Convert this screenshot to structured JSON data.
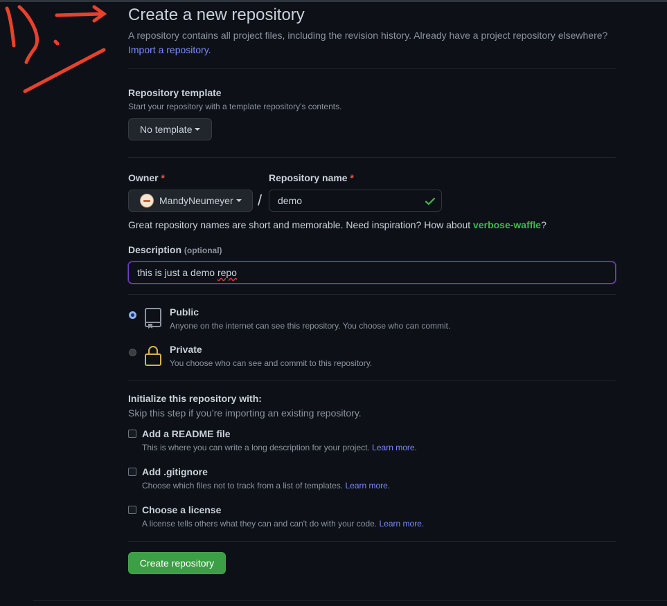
{
  "header": {
    "title": "Create a new repository",
    "subtitle": "A repository contains all project files, including the revision history. Already have a project repository elsewhere?",
    "import_link": "Import a repository."
  },
  "template": {
    "label": "Repository template",
    "note": "Start your repository with a template repository's contents.",
    "button": "No template"
  },
  "owner": {
    "label": "Owner",
    "required_mark": "*",
    "value": "MandyNeumeyer"
  },
  "separator": "/",
  "repo_name": {
    "label": "Repository name",
    "required_mark": "*",
    "value": "demo"
  },
  "suggestion": {
    "text": "Great repository names are short and memorable. Need inspiration? How about ",
    "name": "verbose-waffle",
    "end": "?"
  },
  "description": {
    "label": "Description",
    "optional": "(optional)",
    "value_prefix": "this is just a demo ",
    "value_misspelled": "repo"
  },
  "visibility": {
    "public": {
      "title": "Public",
      "desc": "Anyone on the internet can see this repository. You choose who can commit.",
      "selected": true
    },
    "private": {
      "title": "Private",
      "desc": "You choose who can see and commit to this repository.",
      "selected": false
    }
  },
  "init": {
    "title": "Initialize this repository with:",
    "note": "Skip this step if you’re importing an existing repository.",
    "options": [
      {
        "title": "Add a README file",
        "desc": "This is where you can write a long description for your project.",
        "link": "Learn more.",
        "checked": false
      },
      {
        "title": "Add .gitignore",
        "desc": "Choose which files not to track from a list of templates.",
        "link": "Learn more.",
        "checked": false
      },
      {
        "title": "Choose a license",
        "desc": "A license tells others what they can and can't do with your code.",
        "link": "Learn more.",
        "checked": false
      }
    ]
  },
  "submit": {
    "label": "Create repository"
  },
  "colors": {
    "background": "#0d1117",
    "accent_link": "#7b8bff",
    "success_green": "#3fb950",
    "button_green": "#3c9e45",
    "annotation_red": "#e8412c",
    "private_lock": "#d8b34a"
  },
  "icons": {
    "caret": "caret-down-icon",
    "check": "check-icon",
    "repo": "repo-icon",
    "lock": "lock-icon"
  }
}
